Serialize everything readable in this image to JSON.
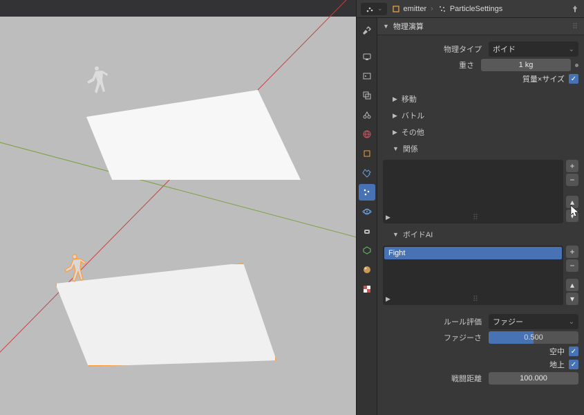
{
  "header": {
    "datablock1": "emitter",
    "datablock2": "ParticleSettings"
  },
  "panels": {
    "physics_title": "物理演算",
    "physics_type_label": "物理タイプ",
    "physics_type_value": "ボイド",
    "mass_label": "重さ",
    "mass_value": "1 kg",
    "mass_x_size_label": "質量×サイズ",
    "sub_movement": "移動",
    "sub_battle": "バトル",
    "sub_other": "その他",
    "sub_relation": "関係",
    "boid_ai_title": "ボイドAI",
    "boid_rule_item": "Fight",
    "rule_eval_label": "ルール評価",
    "rule_eval_value": "ファジー",
    "fuzziness_label": "ファジーさ",
    "fuzziness_value": "0.500",
    "in_air_label": "空中",
    "on_land_label": "地上",
    "combat_dist_label": "戦闘距離",
    "combat_dist_value": "100.000"
  }
}
